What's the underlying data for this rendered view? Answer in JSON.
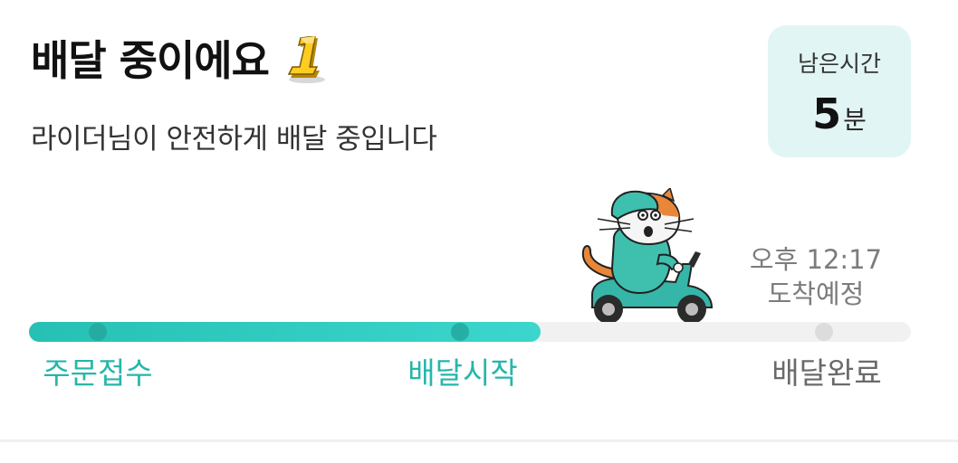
{
  "header": {
    "title": "배달 중이에요",
    "subtitle": "라이더님이 안전하게 배달 중입니다"
  },
  "remaining_time": {
    "label": "남은시간",
    "value": "5",
    "unit": "분"
  },
  "eta": {
    "time": "오후 12:17",
    "label": "도착예정"
  },
  "progress": {
    "fraction": 0.58,
    "steps": [
      {
        "label": "주문접수",
        "status": "done"
      },
      {
        "label": "배달시작",
        "status": "done"
      },
      {
        "label": "배달완료",
        "status": "todo"
      }
    ]
  },
  "colors": {
    "accent": "#27b6ab",
    "time_box_bg": "#e1f5f4",
    "track_bg": "#f1f1f1"
  },
  "icons": {
    "title_badge": "number-one-badge-icon",
    "rider": "cat-rider-scooter-icon"
  }
}
